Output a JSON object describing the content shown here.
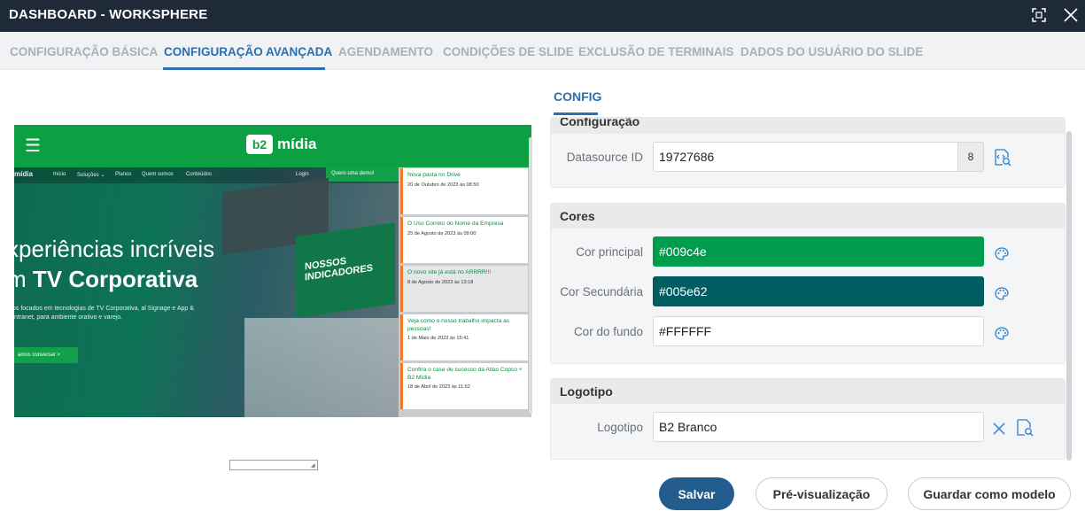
{
  "window": {
    "title": "DASHBOARD - WORKSPHERE",
    "maximize_icon": "maximize-icon",
    "close_icon": "close-icon"
  },
  "tabs": [
    {
      "label": "CONFIGURAÇÃO BÁSICA",
      "active": false
    },
    {
      "label": "CONFIGURAÇÃO AVANÇADA",
      "active": true
    },
    {
      "label": "AGENDAMENTO",
      "active": false
    },
    {
      "label": "CONDIÇÕES DE SLIDE",
      "active": false
    },
    {
      "label": "EXCLUSÃO DE TERMINAIS",
      "active": false
    },
    {
      "label": "DADOS DO USUÁRIO DO SLIDE",
      "active": false
    }
  ],
  "preview": {
    "logo_mark": "b2",
    "logo_text": "mídia",
    "nav": {
      "brand": "mídia",
      "items": [
        "Início",
        "Soluções ⌄",
        "Planos",
        "Quem somos",
        "Conteúdos"
      ],
      "login": "Login",
      "demo": "Quero uma demo!"
    },
    "screen_text": "NOSSOS INDICADORES",
    "headline_line1": "xperiências incríveis",
    "headline_line2_prefix": "m ",
    "headline_line2_bold": "TV Corporativa",
    "description": "os focados em tecnologias de TV Corporativa, al Signage e App & Intranet, para ambiente orativo e varejo.",
    "cta": "amos conversar  >",
    "feed": [
      {
        "title": "Nova pasta no Drive",
        "date": "20 de Outubro de 2023 às 08:50",
        "highlight": false
      },
      {
        "title": "O Uso Correto do Nome da Empresa",
        "date": "25 de Agosto de 2023 às 09:00",
        "highlight": false
      },
      {
        "title": "O novo site já está no ARRRR!!!",
        "date": "8 de Agosto de 2023 às 13:18",
        "highlight": true
      },
      {
        "title": "Veja como o nosso trabalho impacta as pessoas!",
        "date": "1 de Maio de 2023 às 15:41",
        "highlight": false
      },
      {
        "title": "Confira o case de sucesso da Atlas Copco + B2 Mídia",
        "date": "18 de Abril de 2023 às 11:52",
        "highlight": false
      }
    ]
  },
  "config": {
    "tab_label": "CONFIG",
    "configuracao": {
      "title": "Configuração",
      "datasource_label": "Datasource ID",
      "datasource_value": "19727686",
      "datasource_badge": "8"
    },
    "cores": {
      "title": "Cores",
      "principal_label": "Cor principal",
      "principal_value": "#009c4e",
      "secundaria_label": "Cor Secundária",
      "secundaria_value": "#005e62",
      "fundo_label": "Cor do fundo",
      "fundo_value": "#FFFFFF"
    },
    "logotipo": {
      "title": "Logotipo",
      "label": "Logotipo",
      "value": "B2 Branco"
    }
  },
  "buttons": {
    "save": "Salvar",
    "preview": "Pré-visualização",
    "save_template": "Guardar como modelo"
  },
  "colors": {
    "accent": "#2c6fb0",
    "titlebar": "#1f2a38",
    "primary_button": "#235d8e",
    "brand_green": "#009c4e",
    "brand_teal": "#005e62"
  }
}
